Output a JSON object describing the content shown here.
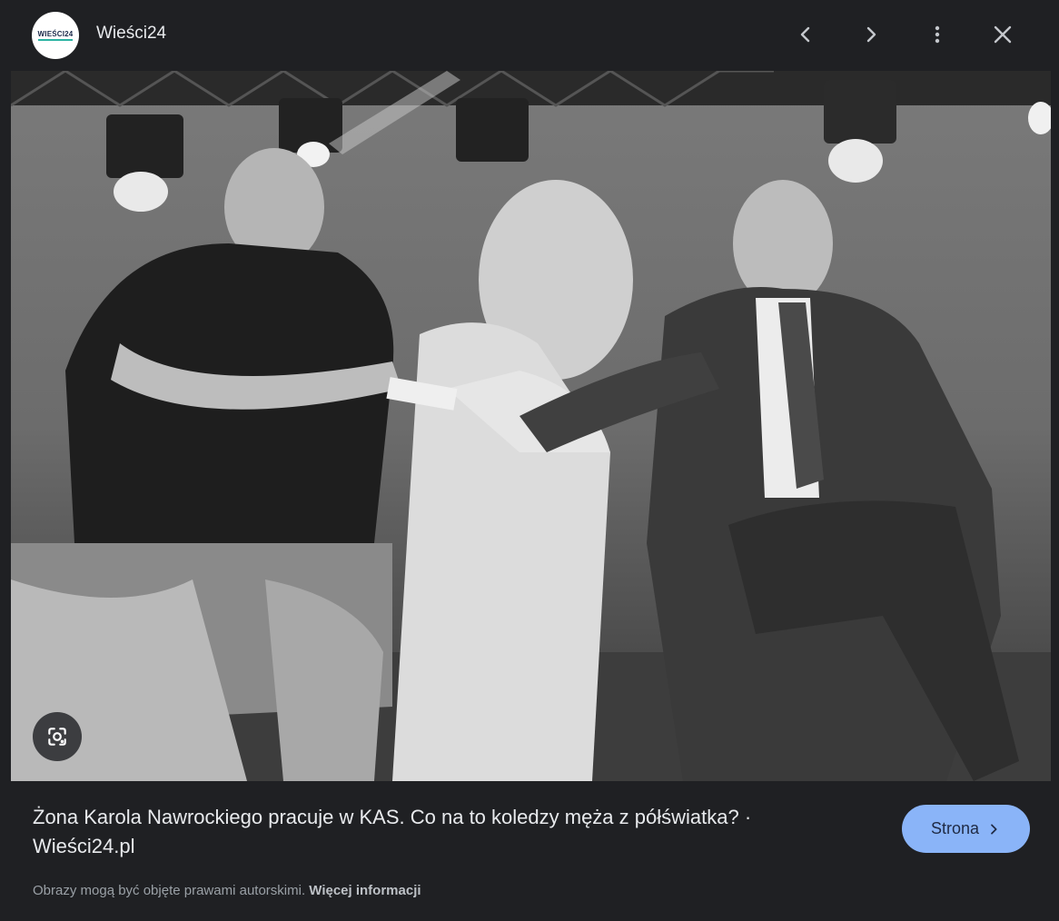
{
  "header": {
    "logo_text": "WIEŚCI24",
    "site_name": "Wieści24"
  },
  "icons": {
    "prev": "chevron-left-icon",
    "next": "chevron-right-icon",
    "more": "more-vert-icon",
    "close": "close-icon",
    "lens": "google-lens-icon"
  },
  "caption": {
    "title": "Żona Karola Nawrockiego pracuje w KAS. Co na to koledzy męża z półświatka? · Wieści24.pl"
  },
  "footer": {
    "copyright": "Obrazy mogą być objęte prawami autorskimi. ",
    "more_info": "Więcej informacji"
  },
  "visit_button": {
    "label": "Strona"
  },
  "colors": {
    "background": "#1f2023",
    "accent": "#8ab4f8"
  }
}
